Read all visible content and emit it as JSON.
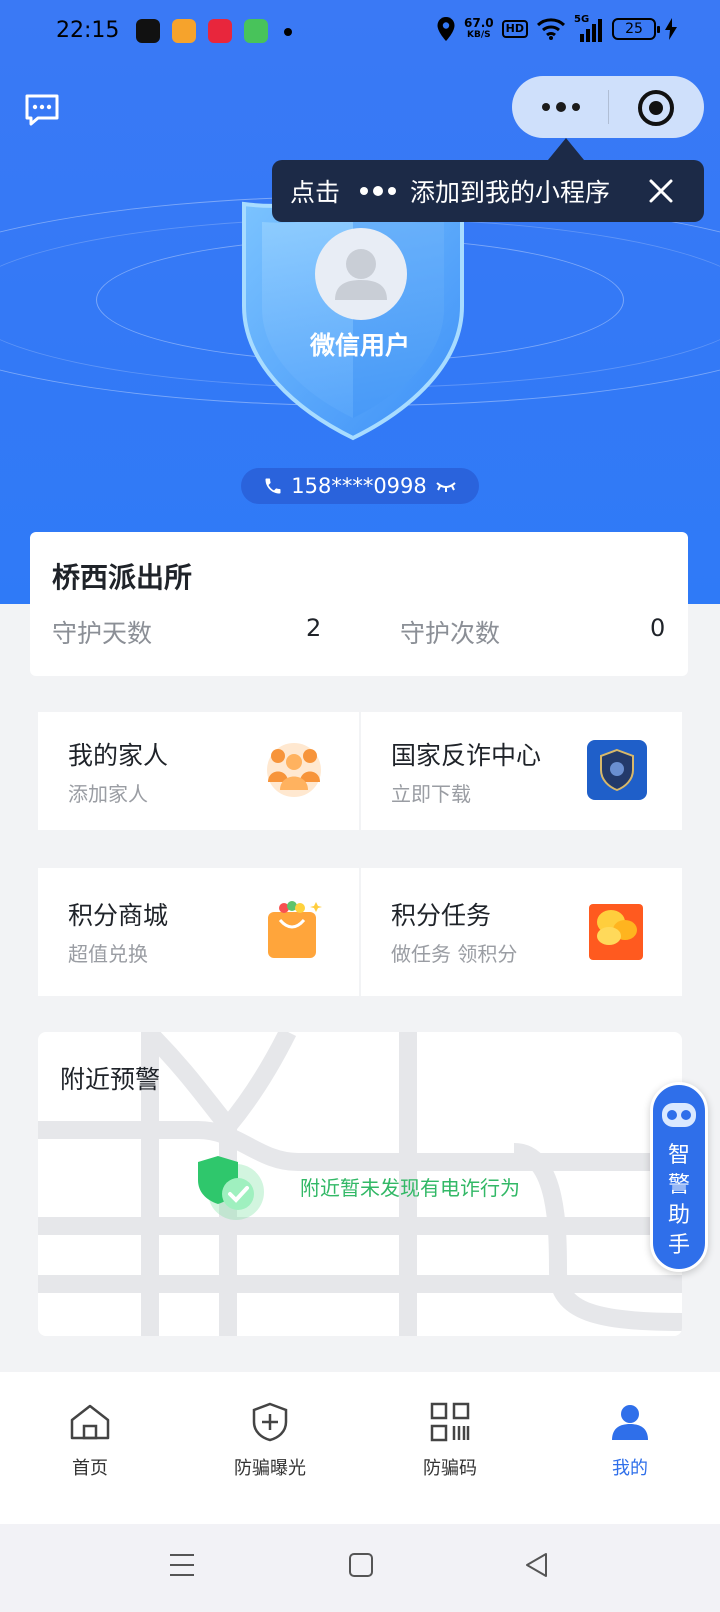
{
  "status_bar": {
    "time": "22:15",
    "net_speed_value": "67.0",
    "net_speed_unit": "KB/S",
    "hd": "HD",
    "signal": "5G",
    "battery": "25"
  },
  "header": {
    "message_icon": "message-square-icon",
    "capsule_more_icon": "more-dots-icon",
    "capsule_close_icon": "target-close-icon"
  },
  "tooltip": {
    "prefix": "点击",
    "suffix": "添加到我的小程序"
  },
  "profile": {
    "name": "微信用户",
    "phone": "158****0998"
  },
  "station": {
    "name": "桥西派出所",
    "guard_days_label": "守护天数",
    "guard_days_value": "2",
    "guard_times_label": "守护次数",
    "guard_times_value": "0"
  },
  "tiles": [
    {
      "title": "我的家人",
      "sub": "添加家人",
      "icon": "family-icon"
    },
    {
      "title": "国家反诈中心",
      "sub": "立即下载",
      "icon": "anti-fraud-app-icon"
    },
    {
      "title": "积分商城",
      "sub": "超值兑换",
      "icon": "shopping-bag-icon"
    },
    {
      "title": "积分任务",
      "sub": "做任务 领积分",
      "icon": "coins-icon"
    }
  ],
  "nearby": {
    "title": "附近预警",
    "message": "附近暂未发现有电诈行为"
  },
  "assistant": {
    "label_1": "智",
    "label_2": "警",
    "label_3": "助",
    "label_4": "手"
  },
  "tabbar": {
    "items": [
      {
        "label": "首页",
        "icon": "home-icon"
      },
      {
        "label": "防骗曝光",
        "icon": "shield-plus-icon"
      },
      {
        "label": "防骗码",
        "icon": "qr-code-icon"
      },
      {
        "label": "我的",
        "icon": "user-icon"
      }
    ],
    "active_index": 3,
    "active_color": "#2f6fea"
  },
  "colors": {
    "hero_blue": "#3379f6",
    "accent": "#2f6fea",
    "success_green": "#32b866"
  }
}
